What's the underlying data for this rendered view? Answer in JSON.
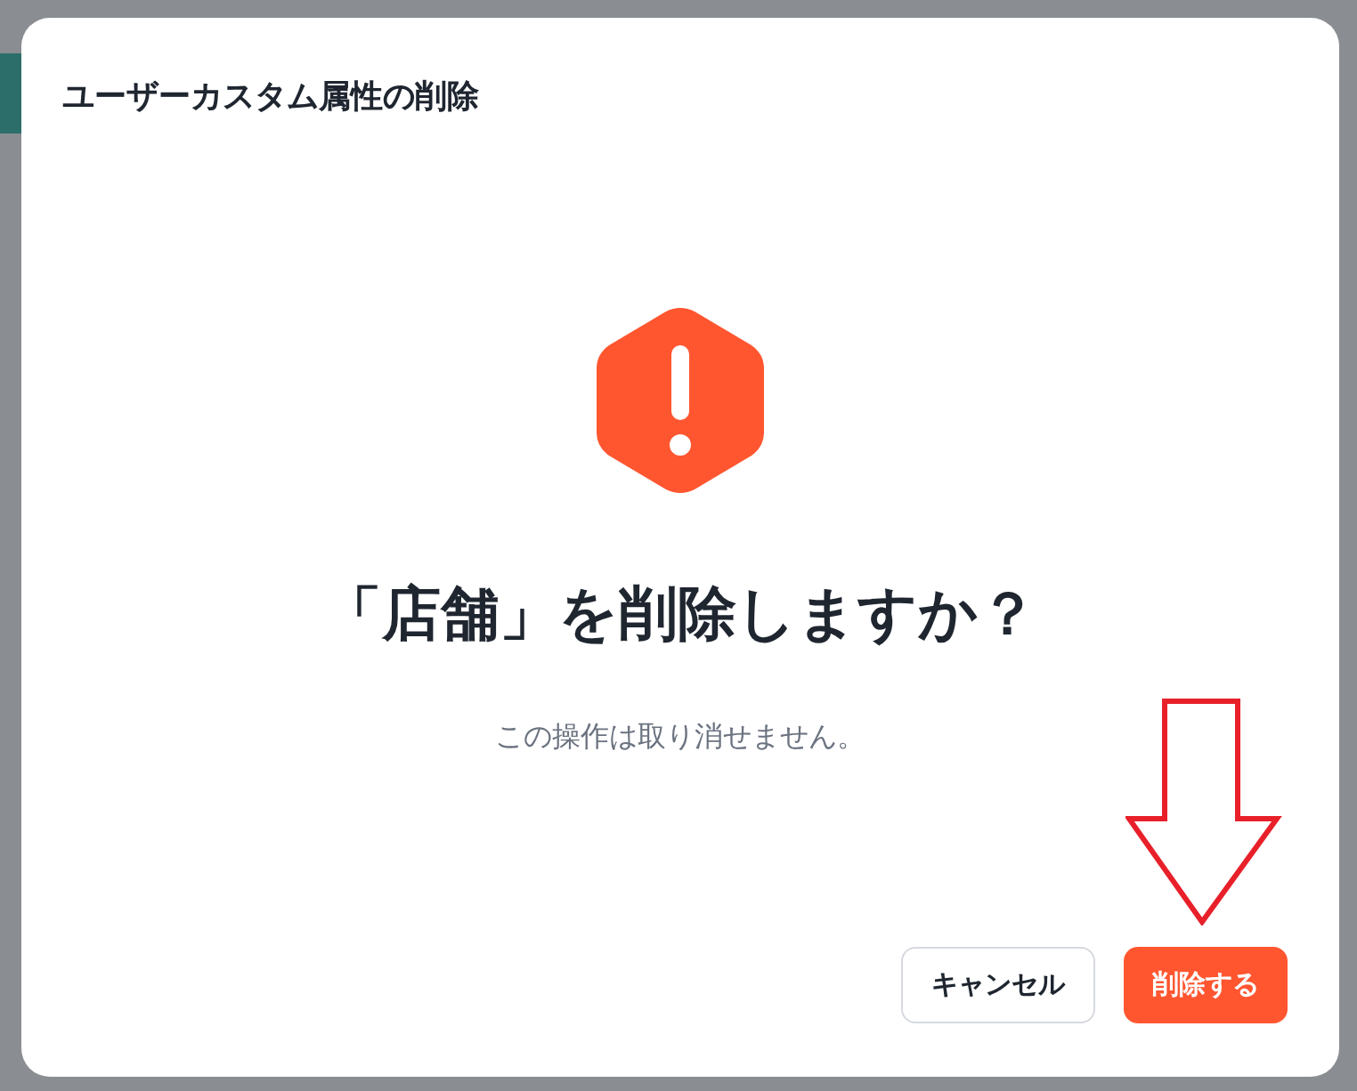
{
  "dialog": {
    "title": "ユーザーカスタム属性の削除",
    "heading": "「店舗」を削除しますか？",
    "message": "この操作は取り消せません。",
    "buttons": [
      {
        "label": "キャンセル",
        "kind": "secondary"
      },
      {
        "label": "削除する",
        "kind": "danger"
      }
    ]
  }
}
